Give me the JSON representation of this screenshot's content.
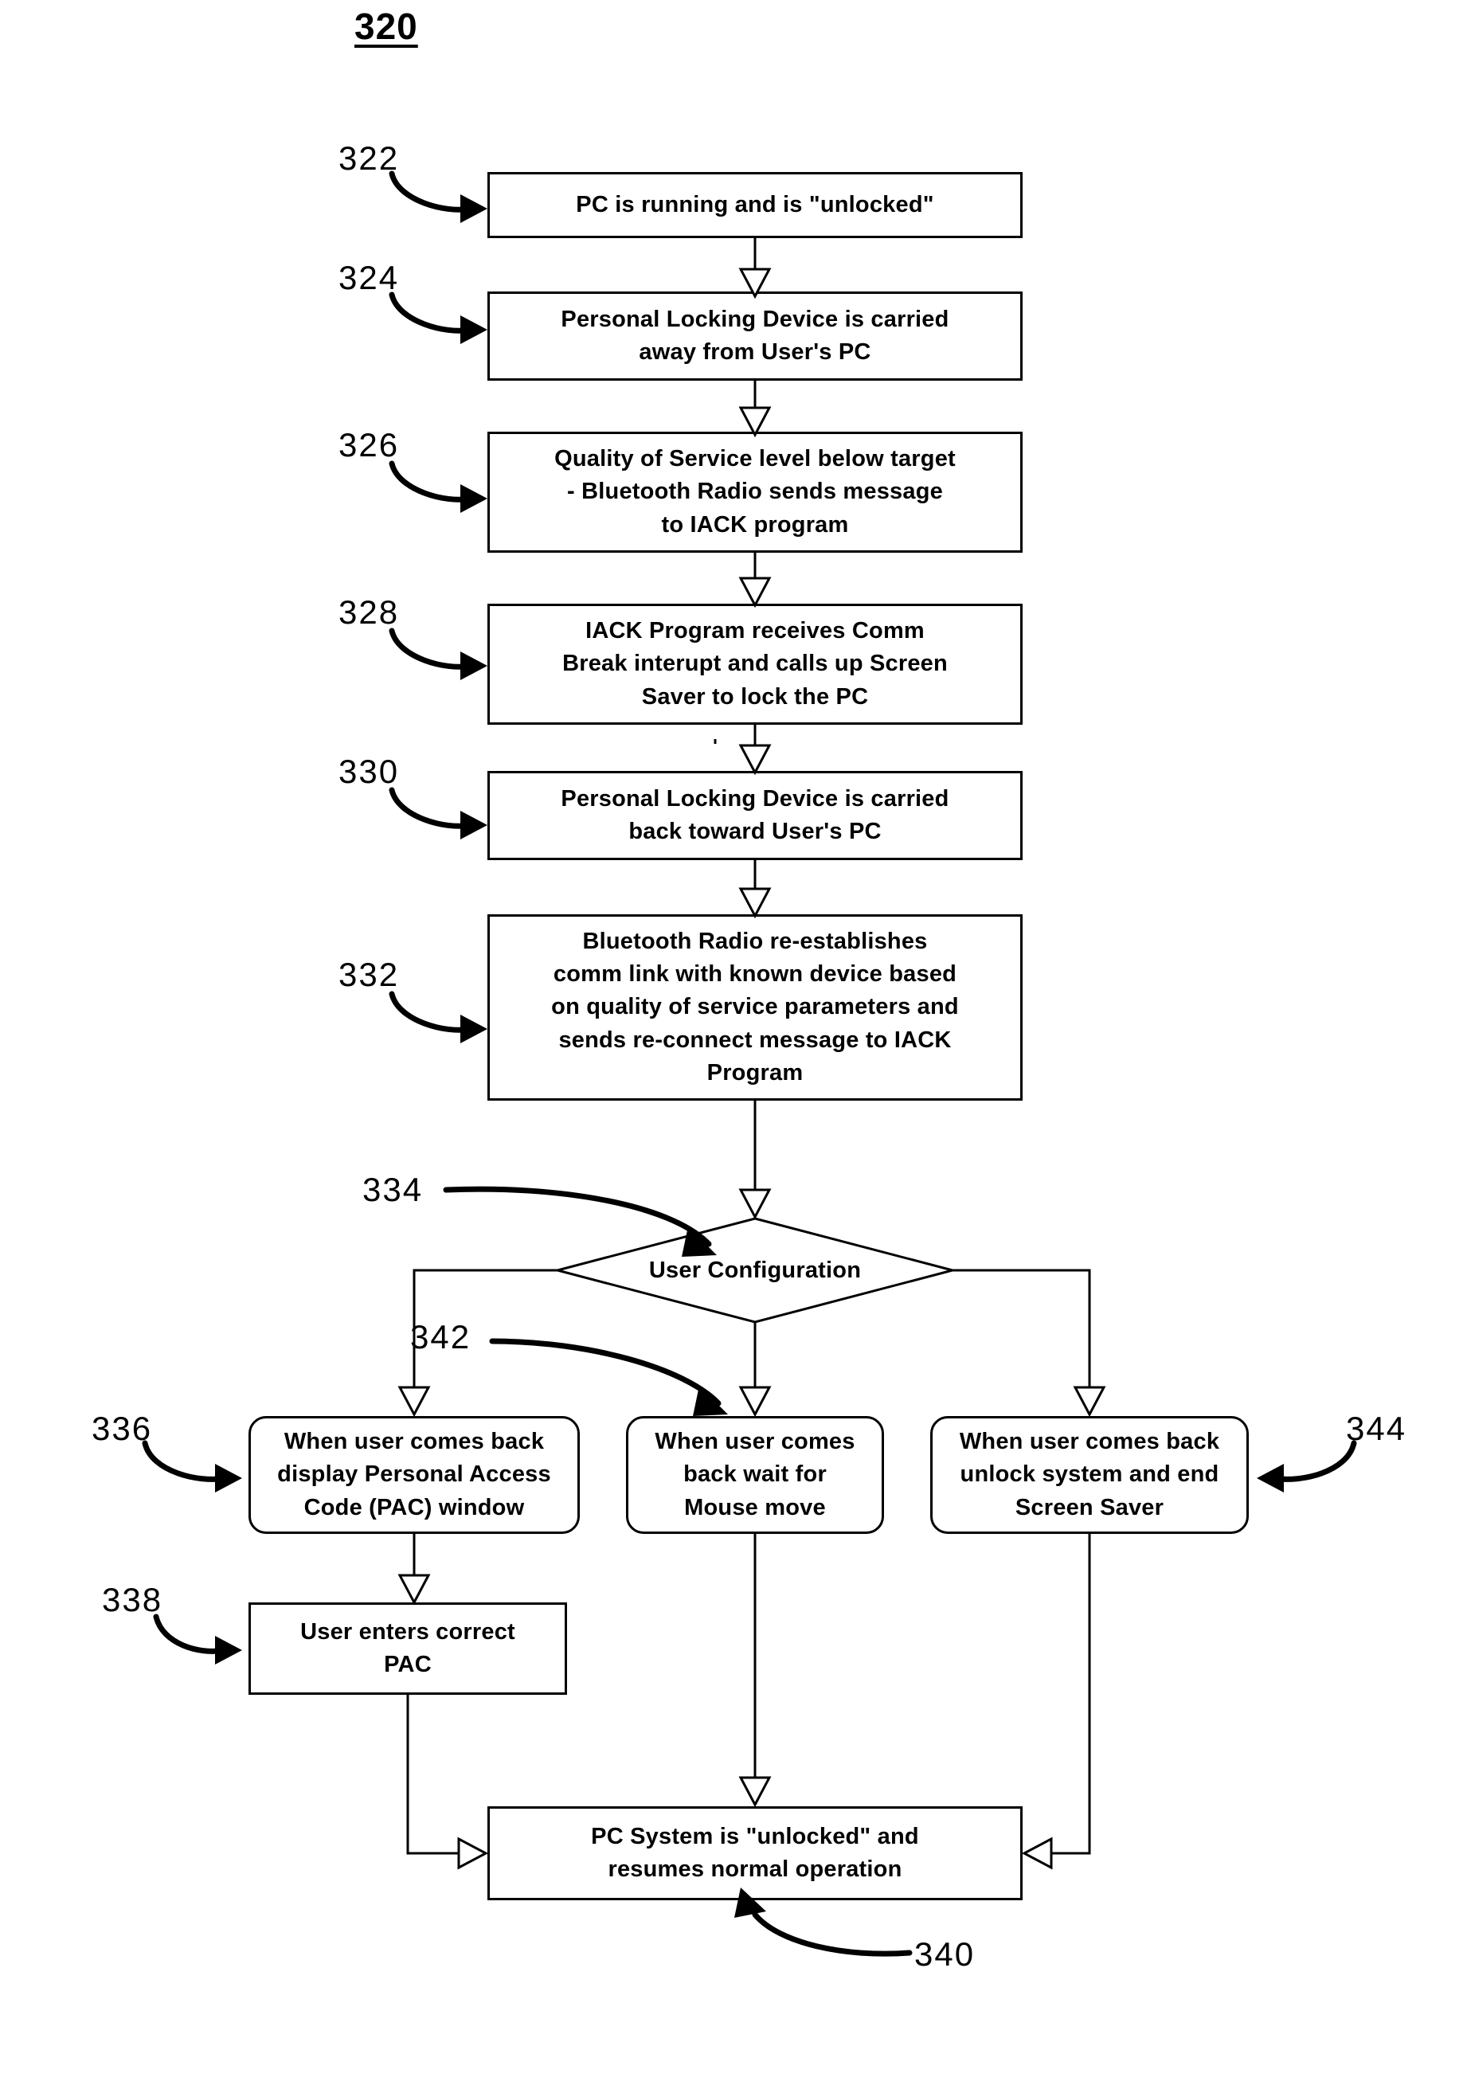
{
  "figure": {
    "number": "320"
  },
  "nodes": [
    {
      "ref": "322",
      "kind": "process",
      "lines": [
        "PC is running and is  \"unlocked\""
      ]
    },
    {
      "ref": "324",
      "kind": "process",
      "lines": [
        "Personal Locking Device is carried",
        "away from User's PC"
      ]
    },
    {
      "ref": "326",
      "kind": "process",
      "lines": [
        "Quality of Service level below target",
        "-  Bluetooth Radio sends message",
        "to IACK program"
      ]
    },
    {
      "ref": "328",
      "kind": "process",
      "lines": [
        "IACK Program receives Comm",
        "Break interupt and calls up Screen",
        "Saver to lock the PC"
      ]
    },
    {
      "ref": "330",
      "kind": "process",
      "lines": [
        "Personal Locking Device is carried",
        "back toward User's PC"
      ]
    },
    {
      "ref": "332",
      "kind": "process",
      "lines": [
        "Bluetooth Radio re-establishes",
        "comm link with known device based",
        "on quality of service parameters and",
        "sends re-connect message to IACK",
        "Program"
      ]
    },
    {
      "ref": "334",
      "kind": "decision",
      "lines": [
        "User Configuration"
      ]
    },
    {
      "ref": "336",
      "kind": "process-rounded",
      "lines": [
        "When user comes back",
        "display Personal Access",
        "Code (PAC) window"
      ]
    },
    {
      "ref": "342",
      "kind": "process-rounded",
      "lines": [
        "When user comes",
        "back  wait for",
        "Mouse move"
      ]
    },
    {
      "ref": "344",
      "kind": "process-rounded",
      "lines": [
        "When user comes back",
        "unlock system and end",
        "Screen Saver"
      ]
    },
    {
      "ref": "338",
      "kind": "process",
      "lines": [
        "User enters correct",
        "PAC"
      ]
    },
    {
      "ref": "340",
      "kind": "process",
      "lines": [
        "PC System is  \"unlocked\" and",
        "resumes normal operation"
      ]
    }
  ],
  "labels": {
    "n320": "320",
    "n322": "322",
    "n324": "324",
    "n326": "326",
    "n328": "328",
    "n330": "330",
    "n332": "332",
    "n334": "334",
    "n336": "336",
    "n338": "338",
    "n340": "340",
    "n342": "342",
    "n344": "344"
  },
  "text": {
    "box322": "PC is running and is  \"unlocked\"",
    "box324_l1": "Personal Locking Device is carried",
    "box324_l2": "away from User's PC",
    "box326_l1": "Quality of Service level below target",
    "box326_l2": "-  Bluetooth Radio sends message",
    "box326_l3": "to IACK program",
    "box328_l1": "IACK Program receives Comm",
    "box328_l2": "Break interupt and calls up Screen",
    "box328_l3": "Saver to lock the PC",
    "box330_l1": "Personal Locking Device is carried",
    "box330_l2": "back toward User's PC",
    "box332_l1": "Bluetooth Radio re-establishes",
    "box332_l2": "comm link with known device based",
    "box332_l3": "on quality of service parameters and",
    "box332_l4": "sends re-connect message to IACK",
    "box332_l5": "Program",
    "diamond334": "User Configuration",
    "box336_l1": "When user comes back",
    "box336_l2": "display Personal Access",
    "box336_l3": "Code (PAC) window",
    "box342_l1": "When user comes",
    "box342_l2": "back  wait for",
    "box342_l3": "Mouse move",
    "box344_l1": "When user comes back",
    "box344_l2": "unlock system and end",
    "box344_l3": "Screen Saver",
    "box338_l1": "User enters correct",
    "box338_l2": "PAC",
    "box340_l1": "PC System is  \"unlocked\" and",
    "box340_l2": "resumes normal operation"
  },
  "colors": {
    "ink": "#000000",
    "paper": "#ffffff"
  }
}
